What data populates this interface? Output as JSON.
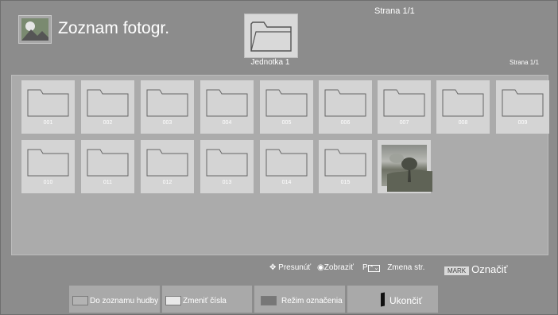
{
  "header": {
    "title": "Zoznam fotogr.",
    "page_top": "Strana 1/1",
    "page_right": "Strana 1/1",
    "drive_label": "Jednotka 1"
  },
  "folders": [
    {
      "label": "001"
    },
    {
      "label": "002"
    },
    {
      "label": "003"
    },
    {
      "label": "004"
    },
    {
      "label": "005"
    },
    {
      "label": "006"
    },
    {
      "label": "007"
    },
    {
      "label": "008"
    },
    {
      "label": "009"
    },
    {
      "label": "010"
    },
    {
      "label": "011"
    },
    {
      "label": "012"
    },
    {
      "label": "013"
    },
    {
      "label": "014"
    },
    {
      "label": "015"
    }
  ],
  "hints": {
    "move": "Presunúť",
    "view": "Zobraziť",
    "page_p": "P",
    "page": "Zmena str.",
    "mark_badge": "MARK",
    "mark": "Označiť"
  },
  "buttons": {
    "music": "Do zoznamu hudby",
    "numbers": "Zmeniť čísla",
    "mark_mode": "Režim označenia",
    "exit": "Ukončiť"
  },
  "colors": {
    "button_yellow": "#e8e8e8",
    "button_green": "#d0d0d0",
    "button_blue": "#777777",
    "background": "#8c8c8c"
  }
}
